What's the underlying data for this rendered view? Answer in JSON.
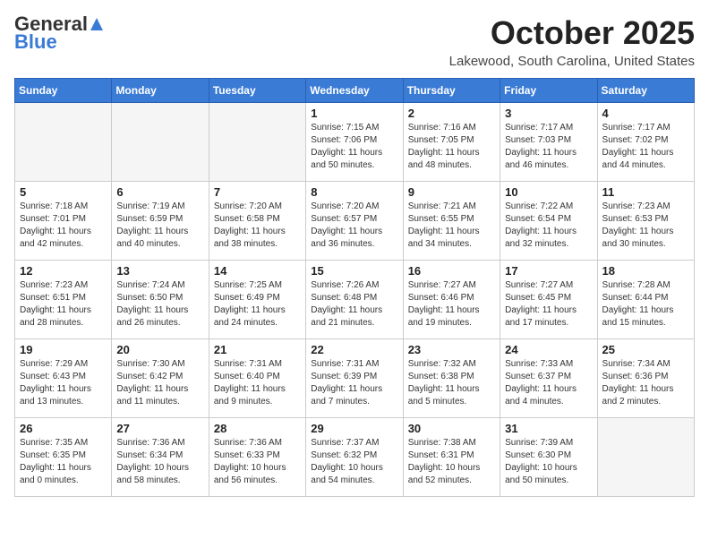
{
  "header": {
    "logo": {
      "general": "General",
      "blue": "Blue"
    },
    "title": "October 2025",
    "location": "Lakewood, South Carolina, United States"
  },
  "weekdays": [
    "Sunday",
    "Monday",
    "Tuesday",
    "Wednesday",
    "Thursday",
    "Friday",
    "Saturday"
  ],
  "weeks": [
    [
      {
        "day": "",
        "info": ""
      },
      {
        "day": "",
        "info": ""
      },
      {
        "day": "",
        "info": ""
      },
      {
        "day": "1",
        "info": "Sunrise: 7:15 AM\nSunset: 7:06 PM\nDaylight: 11 hours\nand 50 minutes."
      },
      {
        "day": "2",
        "info": "Sunrise: 7:16 AM\nSunset: 7:05 PM\nDaylight: 11 hours\nand 48 minutes."
      },
      {
        "day": "3",
        "info": "Sunrise: 7:17 AM\nSunset: 7:03 PM\nDaylight: 11 hours\nand 46 minutes."
      },
      {
        "day": "4",
        "info": "Sunrise: 7:17 AM\nSunset: 7:02 PM\nDaylight: 11 hours\nand 44 minutes."
      }
    ],
    [
      {
        "day": "5",
        "info": "Sunrise: 7:18 AM\nSunset: 7:01 PM\nDaylight: 11 hours\nand 42 minutes."
      },
      {
        "day": "6",
        "info": "Sunrise: 7:19 AM\nSunset: 6:59 PM\nDaylight: 11 hours\nand 40 minutes."
      },
      {
        "day": "7",
        "info": "Sunrise: 7:20 AM\nSunset: 6:58 PM\nDaylight: 11 hours\nand 38 minutes."
      },
      {
        "day": "8",
        "info": "Sunrise: 7:20 AM\nSunset: 6:57 PM\nDaylight: 11 hours\nand 36 minutes."
      },
      {
        "day": "9",
        "info": "Sunrise: 7:21 AM\nSunset: 6:55 PM\nDaylight: 11 hours\nand 34 minutes."
      },
      {
        "day": "10",
        "info": "Sunrise: 7:22 AM\nSunset: 6:54 PM\nDaylight: 11 hours\nand 32 minutes."
      },
      {
        "day": "11",
        "info": "Sunrise: 7:23 AM\nSunset: 6:53 PM\nDaylight: 11 hours\nand 30 minutes."
      }
    ],
    [
      {
        "day": "12",
        "info": "Sunrise: 7:23 AM\nSunset: 6:51 PM\nDaylight: 11 hours\nand 28 minutes."
      },
      {
        "day": "13",
        "info": "Sunrise: 7:24 AM\nSunset: 6:50 PM\nDaylight: 11 hours\nand 26 minutes."
      },
      {
        "day": "14",
        "info": "Sunrise: 7:25 AM\nSunset: 6:49 PM\nDaylight: 11 hours\nand 24 minutes."
      },
      {
        "day": "15",
        "info": "Sunrise: 7:26 AM\nSunset: 6:48 PM\nDaylight: 11 hours\nand 21 minutes."
      },
      {
        "day": "16",
        "info": "Sunrise: 7:27 AM\nSunset: 6:46 PM\nDaylight: 11 hours\nand 19 minutes."
      },
      {
        "day": "17",
        "info": "Sunrise: 7:27 AM\nSunset: 6:45 PM\nDaylight: 11 hours\nand 17 minutes."
      },
      {
        "day": "18",
        "info": "Sunrise: 7:28 AM\nSunset: 6:44 PM\nDaylight: 11 hours\nand 15 minutes."
      }
    ],
    [
      {
        "day": "19",
        "info": "Sunrise: 7:29 AM\nSunset: 6:43 PM\nDaylight: 11 hours\nand 13 minutes."
      },
      {
        "day": "20",
        "info": "Sunrise: 7:30 AM\nSunset: 6:42 PM\nDaylight: 11 hours\nand 11 minutes."
      },
      {
        "day": "21",
        "info": "Sunrise: 7:31 AM\nSunset: 6:40 PM\nDaylight: 11 hours\nand 9 minutes."
      },
      {
        "day": "22",
        "info": "Sunrise: 7:31 AM\nSunset: 6:39 PM\nDaylight: 11 hours\nand 7 minutes."
      },
      {
        "day": "23",
        "info": "Sunrise: 7:32 AM\nSunset: 6:38 PM\nDaylight: 11 hours\nand 5 minutes."
      },
      {
        "day": "24",
        "info": "Sunrise: 7:33 AM\nSunset: 6:37 PM\nDaylight: 11 hours\nand 4 minutes."
      },
      {
        "day": "25",
        "info": "Sunrise: 7:34 AM\nSunset: 6:36 PM\nDaylight: 11 hours\nand 2 minutes."
      }
    ],
    [
      {
        "day": "26",
        "info": "Sunrise: 7:35 AM\nSunset: 6:35 PM\nDaylight: 11 hours\nand 0 minutes."
      },
      {
        "day": "27",
        "info": "Sunrise: 7:36 AM\nSunset: 6:34 PM\nDaylight: 10 hours\nand 58 minutes."
      },
      {
        "day": "28",
        "info": "Sunrise: 7:36 AM\nSunset: 6:33 PM\nDaylight: 10 hours\nand 56 minutes."
      },
      {
        "day": "29",
        "info": "Sunrise: 7:37 AM\nSunset: 6:32 PM\nDaylight: 10 hours\nand 54 minutes."
      },
      {
        "day": "30",
        "info": "Sunrise: 7:38 AM\nSunset: 6:31 PM\nDaylight: 10 hours\nand 52 minutes."
      },
      {
        "day": "31",
        "info": "Sunrise: 7:39 AM\nSunset: 6:30 PM\nDaylight: 10 hours\nand 50 minutes."
      },
      {
        "day": "",
        "info": ""
      }
    ]
  ]
}
